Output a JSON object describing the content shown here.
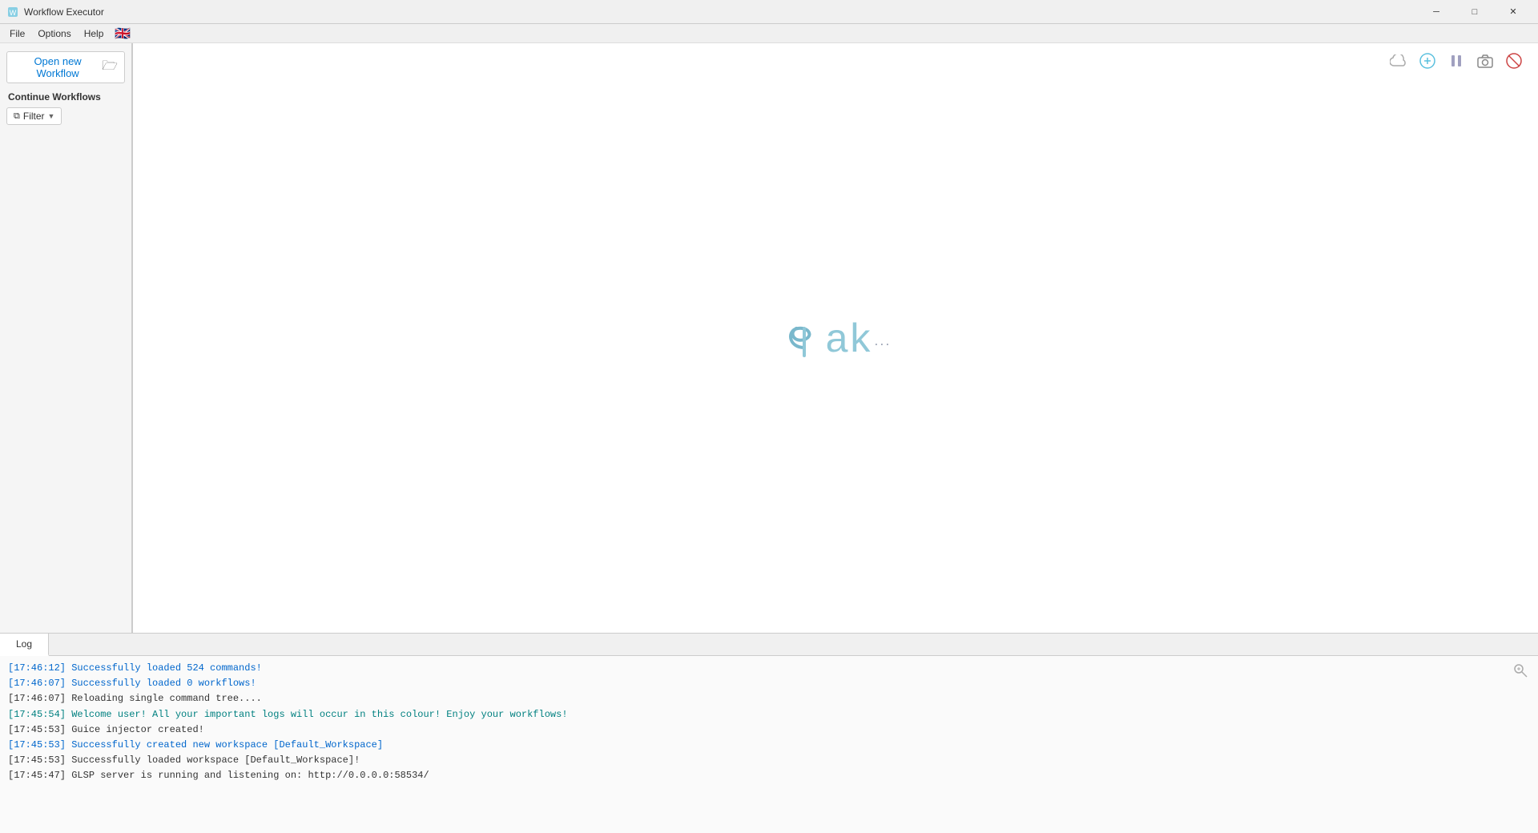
{
  "titleBar": {
    "title": "Workflow Executor",
    "icon": "⚙",
    "controls": {
      "minimize": "─",
      "maximize": "□",
      "close": "✕"
    }
  },
  "menuBar": {
    "items": [
      "File",
      "Options",
      "Help"
    ],
    "flag": "🇬🇧"
  },
  "sidebar": {
    "openWorkflowLabel": "Open new Workflow",
    "folderIcon": "📁",
    "continueWorkflowsLabel": "Continue Workflows",
    "filterLabel": "Filter",
    "filterArrow": "▼"
  },
  "toolbar": {
    "icons": [
      {
        "name": "cloud-icon",
        "symbol": "☁",
        "colorClass": "icon-cloud"
      },
      {
        "name": "add-circle-icon",
        "symbol": "⊕",
        "colorClass": "icon-plus-circle"
      },
      {
        "name": "pause-icon",
        "symbol": "⏸",
        "colorClass": "icon-pause"
      },
      {
        "name": "camera-icon",
        "symbol": "📷",
        "colorClass": "icon-camera"
      },
      {
        "name": "stop-icon",
        "symbol": "⊘",
        "colorClass": "icon-stop"
      }
    ]
  },
  "logo": {
    "textPart": "ak",
    "dots": "..."
  },
  "logPanel": {
    "tabLabel": "Log",
    "entries": [
      {
        "text": "[17:46:12] Successfully loaded 524 commands!",
        "type": "blue"
      },
      {
        "text": "[17:46:07] Successfully loaded 0 workflows!",
        "type": "blue"
      },
      {
        "text": "[17:46:07] Reloading single command tree....",
        "type": "black"
      },
      {
        "text": "[17:45:54] Welcome user! All your important logs will occur in this colour! Enjoy your workflows!",
        "type": "teal"
      },
      {
        "text": "[17:45:53] Guice injector created!",
        "type": "black"
      },
      {
        "text": "[17:45:53] Successfully created new workspace [Default_Workspace]",
        "type": "blue"
      },
      {
        "text": "[17:45:53] Successfully loaded workspace [Default_Workspace]!",
        "type": "black"
      },
      {
        "text": "[17:45:47] GLSP server is running and listening on: http://0.0.0.0:58534/",
        "type": "black"
      }
    ],
    "searchIcon": "🔍"
  }
}
